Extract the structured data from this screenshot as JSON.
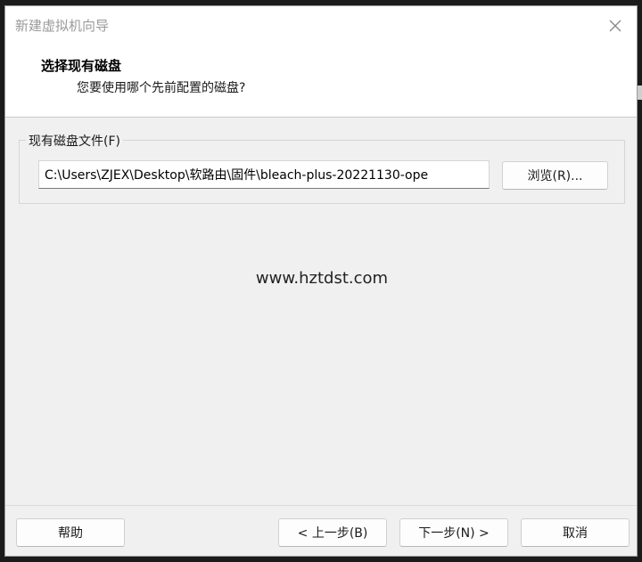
{
  "window": {
    "title": "新建虚拟机向导"
  },
  "header": {
    "title": "选择现有磁盘",
    "subtitle": "您要使用哪个先前配置的磁盘?"
  },
  "disk_group": {
    "label": "现有磁盘文件(F)",
    "path_value": "C:\\Users\\ZJEX\\Desktop\\软路由\\固件\\bleach-plus-20221130-ope",
    "browse_label": "浏览(R)..."
  },
  "watermark": "www.hztdst.com",
  "footer": {
    "help_label": "帮助",
    "back_label": "< 上一步(B)",
    "next_label": "下一步(N) >",
    "cancel_label": "取消"
  },
  "icons": {
    "close": "close-icon"
  }
}
